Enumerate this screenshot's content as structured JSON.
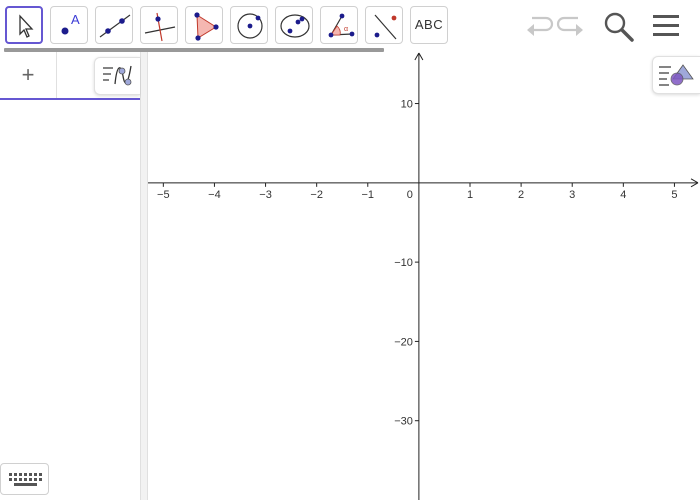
{
  "toolbar": {
    "tools": [
      {
        "name": "move-tool",
        "icon": "arrow-cursor-icon",
        "selected": true
      },
      {
        "name": "point-tool",
        "icon": "point-icon",
        "label": "A"
      },
      {
        "name": "line-tool",
        "icon": "line-through-two-points-icon"
      },
      {
        "name": "perpendicular-line-tool",
        "icon": "perpendicular-line-icon"
      },
      {
        "name": "polygon-tool",
        "icon": "polygon-icon"
      },
      {
        "name": "circle-tool",
        "icon": "circle-center-point-icon"
      },
      {
        "name": "conic-tool",
        "icon": "ellipse-icon"
      },
      {
        "name": "angle-tool",
        "icon": "angle-icon"
      },
      {
        "name": "reflect-tool",
        "icon": "reflect-about-line-icon"
      },
      {
        "name": "text-tool",
        "icon": "text-icon",
        "label": "ABC"
      }
    ],
    "undo_icon": "undo-icon",
    "redo_icon": "redo-icon",
    "search_icon": "search-icon",
    "menu_icon": "menu-icon"
  },
  "algebra": {
    "add_label": "+",
    "style_icon": "algebra-style-icon",
    "keyboard_icon": "keyboard-icon"
  },
  "graphics": {
    "style_icon": "graphics-style-icon",
    "accent_color": "#6557d2"
  },
  "chart_data": {
    "type": "scatter",
    "title": "",
    "xlabel": "",
    "ylabel": "",
    "xlim": [
      -5.3,
      5.5
    ],
    "ylim": [
      -40,
      16.5
    ],
    "x_ticks": [
      -5,
      -4,
      -3,
      -2,
      -1,
      1,
      2,
      3,
      4,
      5
    ],
    "y_ticks": [
      10,
      -10,
      -20,
      -30
    ],
    "x_tick_labels": [
      "−5",
      "−4",
      "−3",
      "−2",
      "−1",
      "1",
      "2",
      "3",
      "4",
      "5"
    ],
    "y_tick_labels": [
      "10",
      "−10",
      "−20",
      "−30"
    ],
    "origin_label": "0",
    "grid": false,
    "series": []
  }
}
